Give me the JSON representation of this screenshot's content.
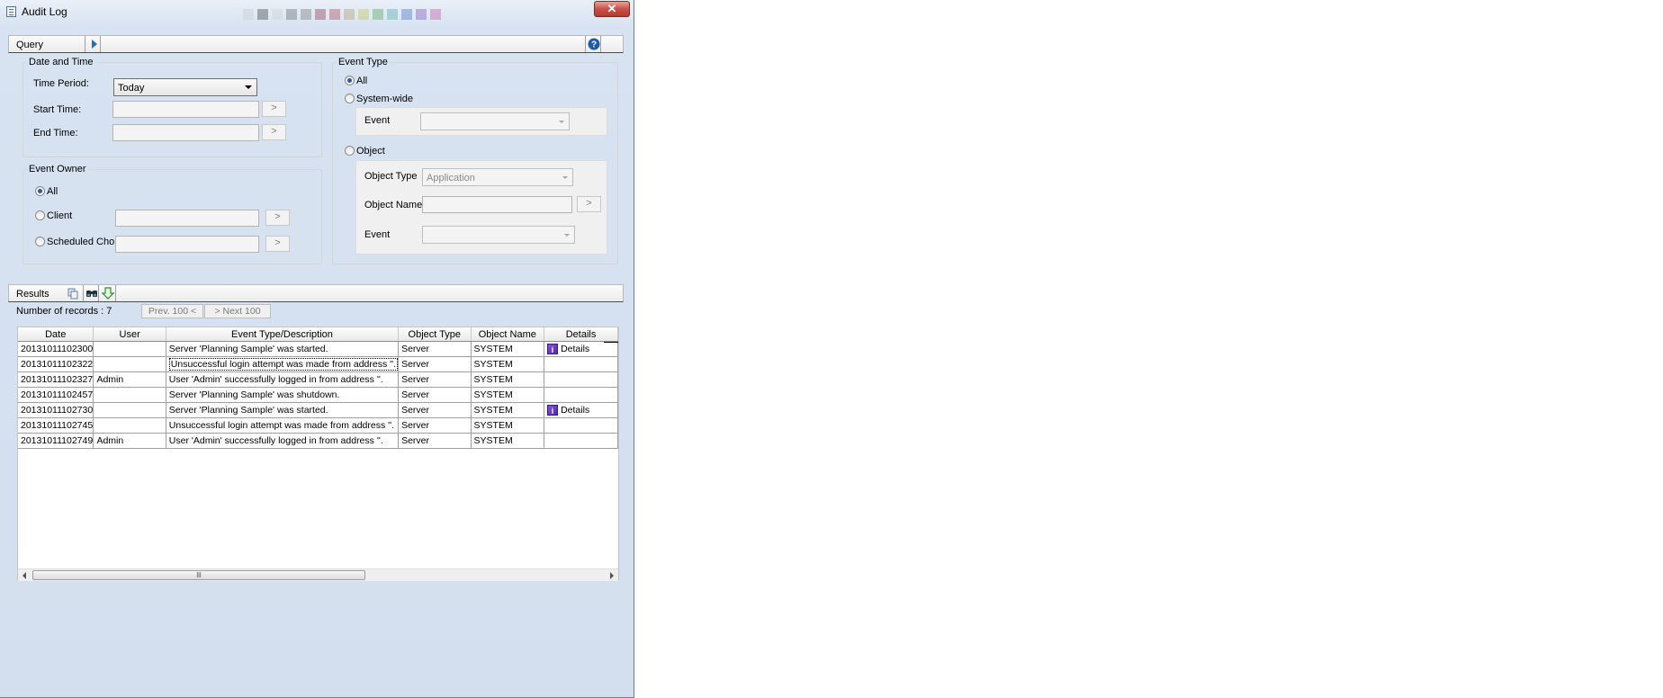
{
  "window": {
    "title": "Audit Log",
    "close_glyph": "✕",
    "title_swatch_colors": [
      "#c8c8c8",
      "#2a2a2a",
      "#d0d0d0",
      "#555555",
      "#6a6a6a",
      "#8b2030",
      "#a83040",
      "#b09060",
      "#c0c040",
      "#40a040",
      "#40a0a0",
      "#3060c0",
      "#7040b0",
      "#c040a0"
    ]
  },
  "query": {
    "label": "Query",
    "expand_icon": "play-arrow-icon",
    "help_icon": "help-icon",
    "date_time": {
      "legend": "Date and Time",
      "time_period_label": "Time Period:",
      "time_period_value": "Today",
      "start_time_label": "Start Time:",
      "end_time_label": "End Time:",
      "picker_label": ">"
    },
    "event_owner": {
      "legend": "Event Owner",
      "all_label": "All",
      "client_label": "Client",
      "scheduled_chore_label": "Scheduled Chore",
      "picker_label": ">"
    },
    "event_type": {
      "legend": "Event Type",
      "all_label": "All",
      "system_wide_label": "System-wide",
      "event_label": "Event",
      "object_label": "Object",
      "object_type_label": "Object Type",
      "object_type_value": "Application",
      "object_name_label": "Object Name",
      "object_event_label": "Event",
      "picker_label": ">"
    }
  },
  "results": {
    "label": "Results",
    "toolbar_icons": [
      "copy-icon",
      "find-icon",
      "export-icon"
    ],
    "records_text": "Number of records : 7",
    "prev_label": "Prev. 100 <",
    "next_label": "> Next 100",
    "columns": [
      "Date",
      "User",
      "Event Type/Description",
      "Object Type",
      "Object Name",
      "Details"
    ],
    "rows": [
      {
        "date": "20131011102300",
        "user": "",
        "desc": "Server 'Planning Sample' was started.",
        "object_type": "Server",
        "object_name": "SYSTEM",
        "details": "Details"
      },
      {
        "date": "20131011102322",
        "user": "",
        "desc": "Unsuccessful login attempt was made from address ''.",
        "object_type": "Server",
        "object_name": "SYSTEM",
        "details": ""
      },
      {
        "date": "20131011102327",
        "user": "Admin",
        "desc": "User 'Admin' successfully logged in from address ''.",
        "object_type": "Server",
        "object_name": "SYSTEM",
        "details": ""
      },
      {
        "date": "20131011102457",
        "user": "",
        "desc": "Server 'Planning Sample' was shutdown.",
        "object_type": "Server",
        "object_name": "SYSTEM",
        "details": ""
      },
      {
        "date": "20131011102730",
        "user": "",
        "desc": "Server 'Planning Sample' was started.",
        "object_type": "Server",
        "object_name": "SYSTEM",
        "details": "Details"
      },
      {
        "date": "20131011102745",
        "user": "",
        "desc": "Unsuccessful login attempt was made from address ''.",
        "object_type": "Server",
        "object_name": "SYSTEM",
        "details": ""
      },
      {
        "date": "20131011102749",
        "user": "Admin",
        "desc": "User 'Admin' successfully logged in from address ''.",
        "object_type": "Server",
        "object_name": "SYSTEM",
        "details": ""
      }
    ],
    "scroll_grip": "lll"
  }
}
